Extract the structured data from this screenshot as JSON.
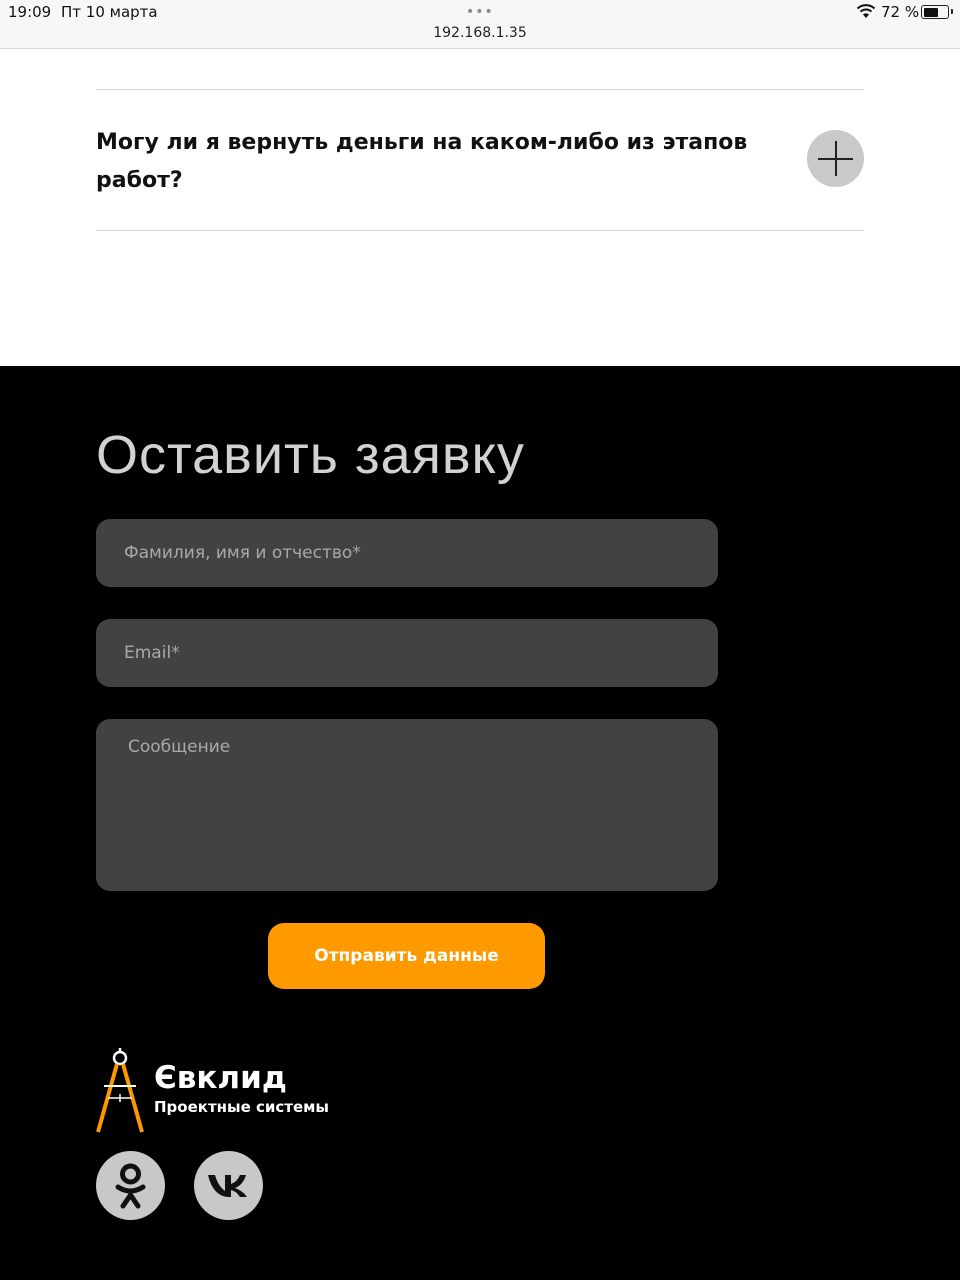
{
  "status_bar": {
    "time": "19:09",
    "date": "Пт 10 марта",
    "url": "192.168.1.35",
    "battery_percent": "72 %",
    "battery_level": 0.72
  },
  "faq": {
    "question": "Могу ли я вернуть деньги на каком-либо из этапов работ?",
    "toggle_icon": "plus-icon"
  },
  "form": {
    "title": "Оставить заявку",
    "name_placeholder": "Фамилия, имя и отчество*",
    "email_placeholder": "Email*",
    "message_placeholder": "Сообщение",
    "submit_label": "Отправить данные",
    "accent_color": "#ff9900"
  },
  "brand": {
    "name": "Євклид",
    "tagline": "Проектные системы",
    "logo_icon": "compass-icon"
  },
  "social": [
    {
      "name": "odnoklassniki",
      "icon": "odnoklassniki-icon"
    },
    {
      "name": "vkontakte",
      "icon": "vk-icon"
    }
  ]
}
